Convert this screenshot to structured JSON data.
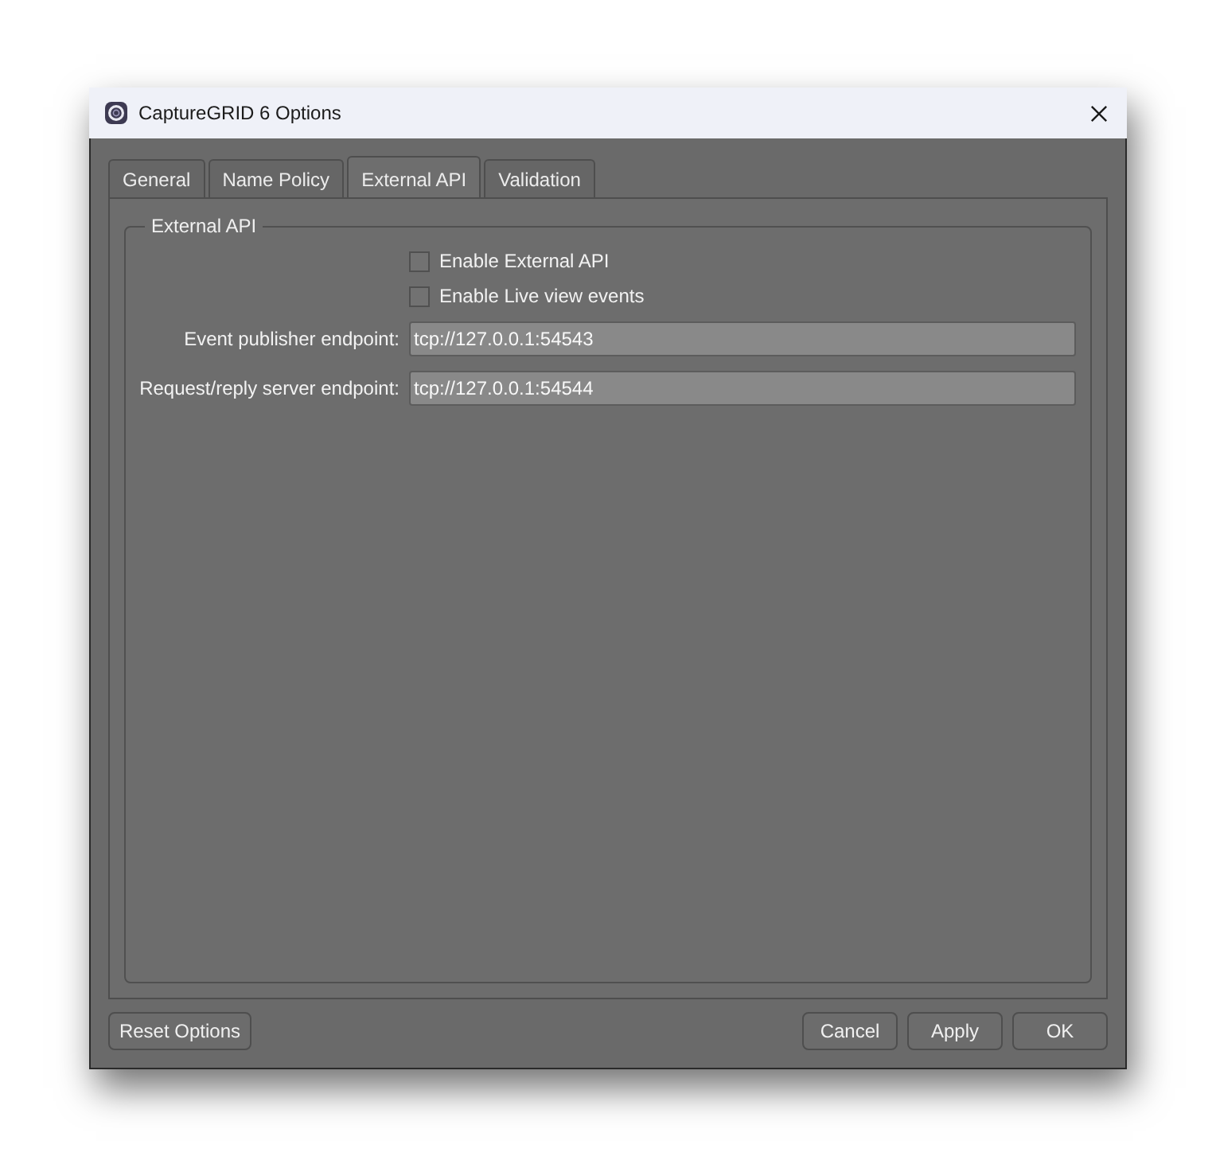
{
  "window": {
    "title": "CaptureGRID 6 Options"
  },
  "tabs": [
    {
      "label": "General",
      "selected": false
    },
    {
      "label": "Name Policy",
      "selected": false
    },
    {
      "label": "External API",
      "selected": true
    },
    {
      "label": "Validation",
      "selected": false
    }
  ],
  "group": {
    "title": "External API",
    "checkboxes": [
      {
        "label": "Enable External API",
        "checked": false
      },
      {
        "label": "Enable Live view events",
        "checked": false
      }
    ],
    "fields": [
      {
        "label": "Event publisher endpoint:",
        "value": "tcp://127.0.0.1:54543"
      },
      {
        "label": "Request/reply server endpoint:",
        "value": "tcp://127.0.0.1:54544"
      }
    ]
  },
  "buttons_left": [
    "Reset Options"
  ],
  "buttons_right": [
    "Cancel",
    "Apply",
    "OK"
  ]
}
